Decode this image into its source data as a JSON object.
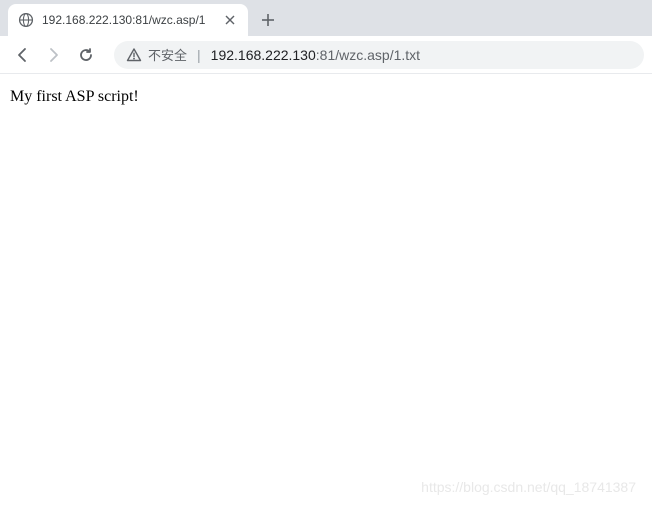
{
  "tab": {
    "title": "192.168.222.130:81/wzc.asp/1",
    "favicon": "globe-icon"
  },
  "toolbar": {
    "back": "←",
    "forward": "→",
    "reload": "↻"
  },
  "addressBar": {
    "securityLabel": "不安全",
    "urlHost": "192.168.222.130",
    "urlPort": ":81",
    "urlPath": "/wzc.asp/1.txt"
  },
  "page": {
    "bodyText": "My first ASP script!"
  },
  "watermark": "https://blog.csdn.net/qq_18741387"
}
